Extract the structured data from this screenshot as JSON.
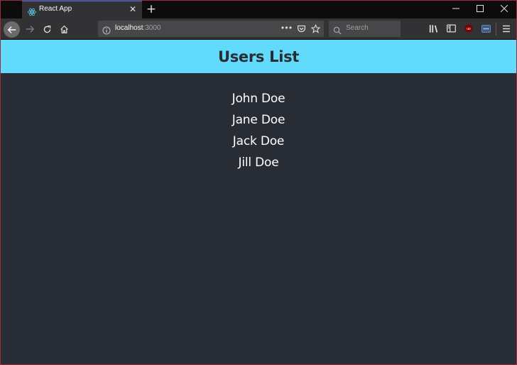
{
  "browser": {
    "tab_title": "React App",
    "url_host": "localhost",
    "url_port": ":3000",
    "search_placeholder": "Search",
    "accent_color": "#0a84ff"
  },
  "app": {
    "title": "Users List",
    "header_color": "#61dafb",
    "background_color": "#282c34",
    "users": [
      "John Doe",
      "Jane Doe",
      "Jack Doe",
      "Jill Doe"
    ]
  }
}
